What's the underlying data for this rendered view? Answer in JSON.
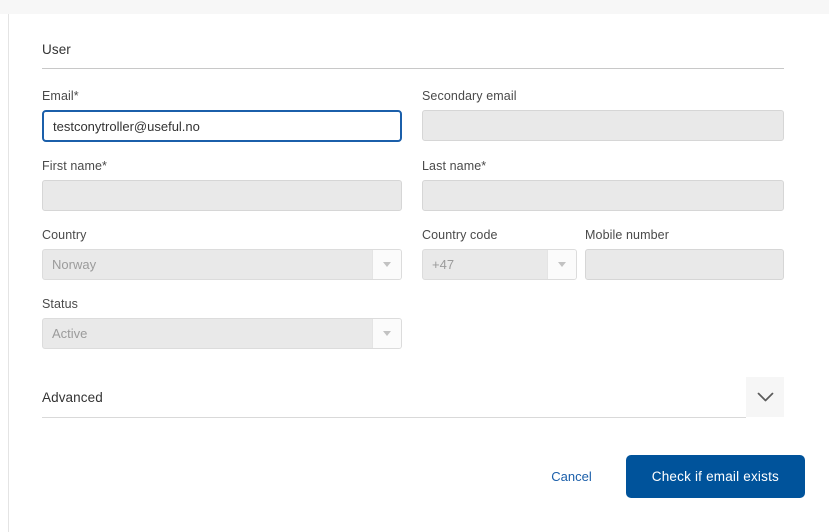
{
  "section": {
    "title": "User"
  },
  "fields": {
    "email": {
      "label": "Email*",
      "value": "testconytroller@useful.no",
      "placeholder": ""
    },
    "secondary_email": {
      "label": "Secondary email",
      "value": "",
      "placeholder": ""
    },
    "first_name": {
      "label": "First name*",
      "value": "",
      "placeholder": ""
    },
    "last_name": {
      "label": "Last name*",
      "value": "",
      "placeholder": ""
    },
    "country": {
      "label": "Country",
      "value": "Norway"
    },
    "country_code": {
      "label": "Country code",
      "value": "+47"
    },
    "mobile_number": {
      "label": "Mobile number",
      "value": "",
      "placeholder": ""
    },
    "status": {
      "label": "Status",
      "value": "Active"
    }
  },
  "advanced": {
    "title": "Advanced",
    "toggle_icon": "chevron-down-icon"
  },
  "footer": {
    "cancel_label": "Cancel",
    "submit_label": "Check if email exists"
  },
  "colors": {
    "primary_button": "#00539b",
    "link": "#1b5faa",
    "focus_border": "#1b5faa",
    "disabled_field": "#e9e9e9"
  }
}
